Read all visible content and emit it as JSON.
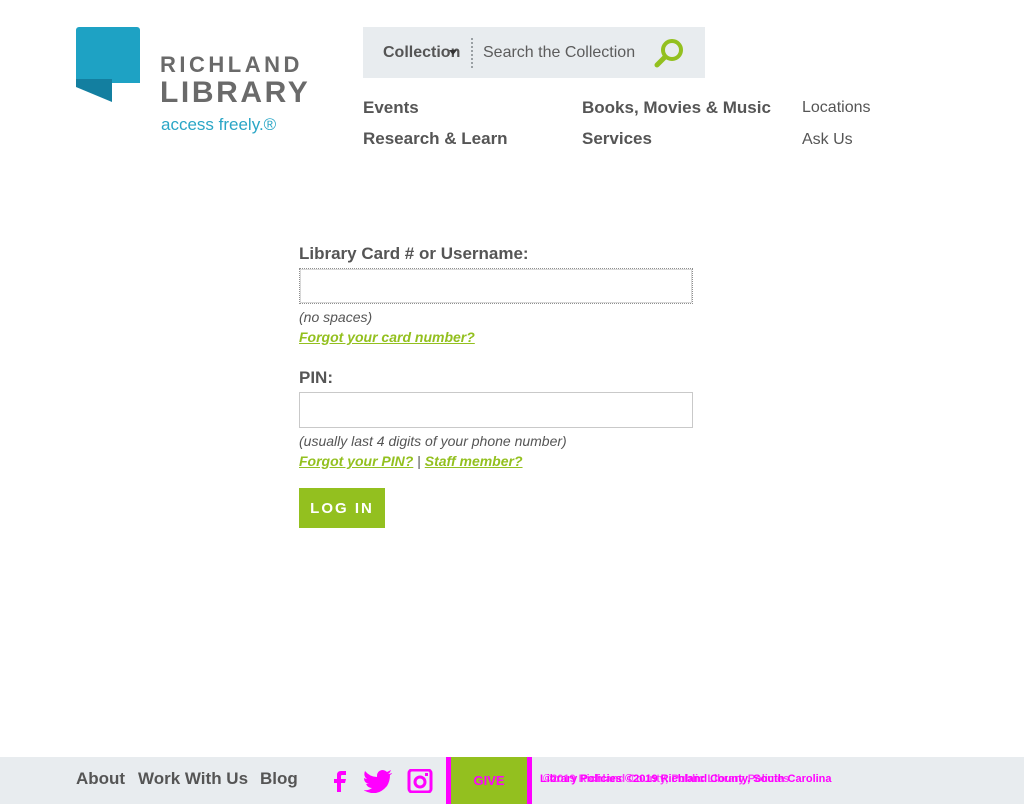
{
  "brand": {
    "name_top": "RICHLAND",
    "name_bottom": "LIBRARY",
    "tagline": "access freely.®",
    "logo_color": "#1ea2c4"
  },
  "search": {
    "scope_label": "Collection",
    "placeholder": "Search the Collection",
    "icon": "search-icon"
  },
  "nav": {
    "primary": [
      "Events",
      "Books, Movies & Music",
      "Research & Learn",
      "Services"
    ],
    "secondary": [
      "Locations",
      "Ask Us"
    ]
  },
  "login": {
    "username_label": "Library Card # or Username:",
    "username_hint": "(no spaces)",
    "forgot_card": "Forgot your card number?",
    "pin_label": "PIN:",
    "pin_hint": "(usually last 4 digits of your phone number)",
    "forgot_pin": "Forgot your PIN?",
    "separator": "|",
    "staff": "Staff member?",
    "submit": "LOG IN"
  },
  "footer": {
    "links": [
      "About",
      "Work With Us",
      "Blog"
    ],
    "social": [
      "facebook-icon",
      "twitter-icon",
      "instagram-icon"
    ],
    "give_label": "GIVE",
    "legal_text": "Library Policies ©2019 Richland County, South Carolina",
    "legal_overlap": "©2019 Richland County, Public Library Policies"
  },
  "colors": {
    "accent_green": "#93c01f",
    "text_gray": "#555555",
    "bar_bg": "#e8ecef",
    "debug_magenta": "#ff00ff"
  }
}
